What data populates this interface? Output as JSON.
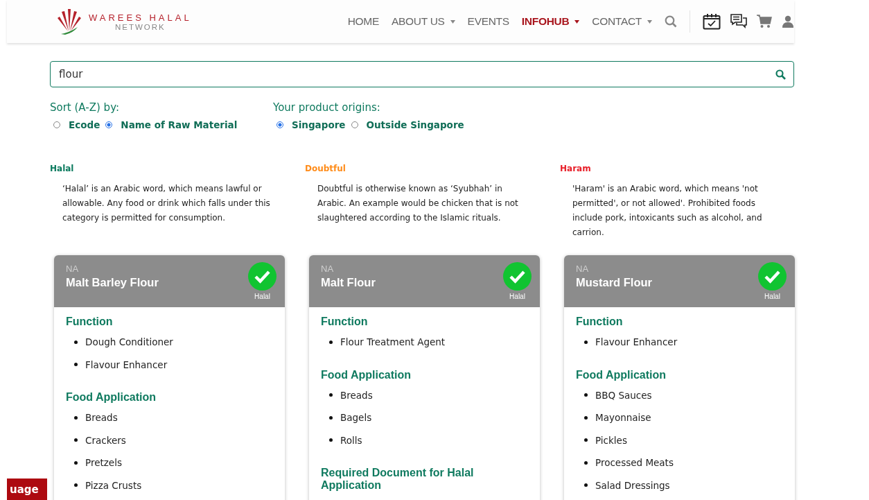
{
  "header": {
    "logo": {
      "line1": "WAREES HALAL",
      "line2": "NETWORK"
    },
    "nav": [
      {
        "label": "HOME",
        "selected": false,
        "dropdown": false
      },
      {
        "label": "ABOUT US",
        "selected": false,
        "dropdown": true
      },
      {
        "label": "EVENTS",
        "selected": false,
        "dropdown": false
      },
      {
        "label": "INFOHUB",
        "selected": true,
        "dropdown": true
      },
      {
        "label": "CONTACT",
        "selected": false,
        "dropdown": true
      }
    ]
  },
  "search": {
    "value": "flour"
  },
  "sort": {
    "label": "Sort (A-Z) by:",
    "options": [
      {
        "label": "Ecode",
        "selected": false
      },
      {
        "label": "Name of Raw Material",
        "selected": true
      }
    ]
  },
  "origins": {
    "label": "Your product origins:",
    "options": [
      {
        "label": "Singapore",
        "selected": true
      },
      {
        "label": "Outside Singapore",
        "selected": false
      }
    ]
  },
  "legend": [
    {
      "kind": "halal",
      "title": "Halal",
      "text": "‘Halal’ is an Arabic word, which means lawful or allowable. Any food or drink which falls under this category is permitted for consumption."
    },
    {
      "kind": "doubtful",
      "title": "Doubtful",
      "text": "Doubtful is otherwise known as ‘Syubhah’ in Arabic. An example would be chicken that is not slaughtered according to the Islamic rituals."
    },
    {
      "kind": "haram",
      "title": "Haram",
      "text": "'Haram' is an Arabic word, which means 'not permitted', or not allowed'. Prohibited foods include pork, intoxicants such as alcohol, and carrion."
    }
  ],
  "cards": [
    {
      "code": "NA",
      "name": "Malt Barley Flour",
      "kind": "halal",
      "status": "Halal",
      "sections": [
        {
          "title": "Function",
          "items": [
            "Dough Conditioner",
            "Flavour Enhancer"
          ]
        },
        {
          "title": "Food Application",
          "items": [
            "Breads",
            "Crackers",
            "Pretzels",
            "Pizza Crusts"
          ]
        }
      ]
    },
    {
      "code": "NA",
      "name": "Malt Flour",
      "kind": "halal",
      "status": "Halal",
      "sections": [
        {
          "title": "Function",
          "items": [
            "Flour Treatment Agent"
          ]
        },
        {
          "title": "Food Application",
          "items": [
            "Breads",
            "Bagels",
            "Rolls"
          ]
        },
        {
          "title": "Required Document for Halal Application"
        }
      ]
    },
    {
      "code": "NA",
      "name": "Mustard Flour",
      "kind": "halal",
      "status": "Halal",
      "sections": [
        {
          "title": "Function",
          "items": [
            "Flavour Enhancer"
          ]
        },
        {
          "title": "Food Application",
          "items": [
            "BBQ Sauces",
            "Mayonnaise",
            "Pickles",
            "Processed Meats",
            "Salad Dressings"
          ]
        }
      ]
    }
  ],
  "language_button": "uage"
}
